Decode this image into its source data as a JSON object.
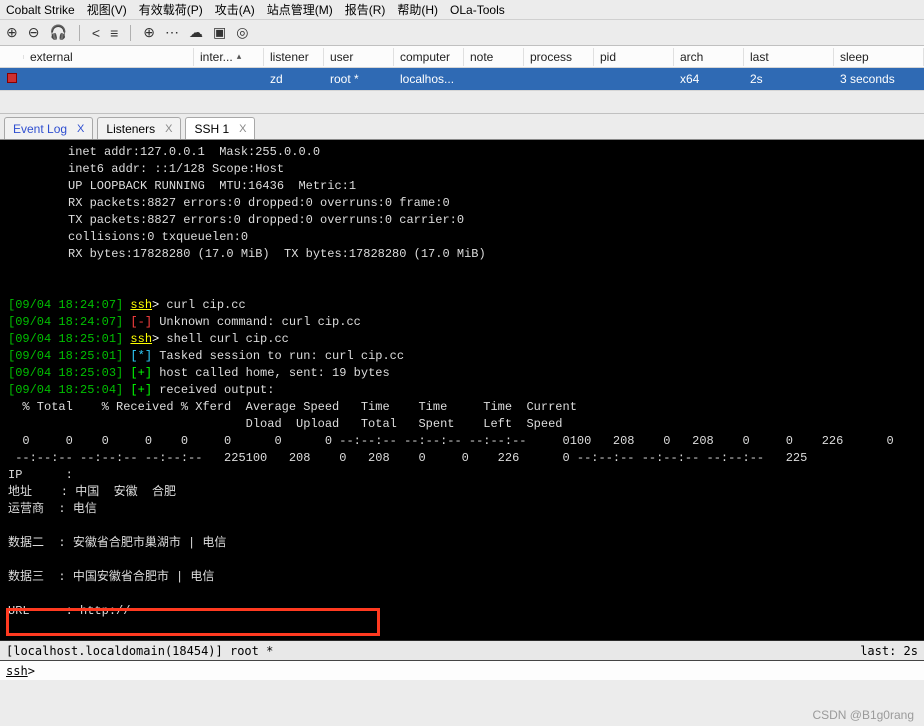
{
  "menubar": {
    "items": [
      "Cobalt Strike",
      "视图(V)",
      "有效载荷(P)",
      "攻击(A)",
      "站点管理(M)",
      "报告(R)",
      "帮助(H)",
      "OLa-Tools"
    ]
  },
  "toolbar": {
    "icons": [
      "plus-icon",
      "minus-circle-icon",
      "headset-icon",
      "share-icon",
      "list-icon",
      "globe-icon",
      "kebab-icon",
      "cloud-icon",
      "target-icon"
    ]
  },
  "targets": {
    "headers": {
      "external": "external",
      "internal": "inter...",
      "listener": "listener",
      "user": "user",
      "computer": "computer",
      "note": "note",
      "process": "process",
      "pid": "pid",
      "arch": "arch",
      "last": "last",
      "sleep": "sleep"
    },
    "row": {
      "external": "",
      "internal": "",
      "listener": "zd       ",
      "user": "root *",
      "computer": "localhos...",
      "note": "",
      "process": "",
      "pid": "",
      "arch": "x64",
      "last": "2s",
      "sleep": "3 seconds"
    }
  },
  "tabs": {
    "items": [
      {
        "label": "Event Log",
        "active": false
      },
      {
        "label": "Listeners",
        "active": false
      },
      {
        "label": "SSH 1",
        "active": true
      }
    ]
  },
  "console": {
    "ifcfg": [
      "inet addr:127.0.0.1  Mask:255.0.0.0",
      "inet6 addr: ::1/128 Scope:Host",
      "UP LOOPBACK RUNNING  MTU:16436  Metric:1",
      "RX packets:8827 errors:0 dropped:0 overruns:0 frame:0",
      "TX packets:8827 errors:0 dropped:0 overruns:0 carrier:0",
      "collisions:0 txqueuelen:0",
      "RX bytes:17828280 (17.0 MiB)  TX bytes:17828280 (17.0 MiB)"
    ],
    "lines": [
      {
        "ts": "[09/04 18:24:07]",
        "tag": "ssh",
        "tagcls": "yellow ul",
        "sym": ">",
        "body": " curl cip.cc"
      },
      {
        "ts": "[09/04 18:24:07]",
        "tag": "[-]",
        "tagcls": "red",
        "sym": "",
        "body": " Unknown command: curl cip.cc"
      },
      {
        "ts": "[09/04 18:25:01]",
        "tag": "ssh",
        "tagcls": "yellow ul",
        "sym": ">",
        "body": " shell curl cip.cc"
      },
      {
        "ts": "[09/04 18:25:01]",
        "tag": "[*]",
        "tagcls": "cyan",
        "sym": "",
        "body": " Tasked session to run: curl cip.cc"
      },
      {
        "ts": "[09/04 18:25:03]",
        "tag": "[+]",
        "tagcls": "lime",
        "sym": "",
        "body": " host called home, sent: 19 bytes"
      },
      {
        "ts": "[09/04 18:25:04]",
        "tag": "[+]",
        "tagcls": "lime",
        "sym": "",
        "body": " received output:"
      }
    ],
    "curl_header": "  % Total    % Received % Xferd  Average Speed   Time    Time     Time  Current",
    "curl_header2": "                                 Dload  Upload   Total   Spent    Left  Speed",
    "curl_row1": "  0     0    0     0    0     0      0      0 --:--:-- --:--:-- --:--:--     0100   208    0   208    0     0    226      0",
    "curl_row2": " --:--:-- --:--:-- --:--:--   225100   208    0   208    0     0    226      0 --:--:-- --:--:-- --:--:--   225",
    "ip_label": "IP      : ",
    "addr_label": "地址    : ",
    "addr_value": "中国  安徽  合肥",
    "isp_label": "运营商  : ",
    "isp_value": "电信",
    "d2_label": "数据二  : ",
    "d2_value": "安徽省合肥市巢湖市 | 电信",
    "d3_label": "数据三  : ",
    "d3_value": "中国安徽省合肥市 | 电信",
    "url_label": "URL     : ",
    "url_value": "http://"
  },
  "status": {
    "left": "[localhost.localdomain(18454)] root *",
    "right": "last: 2s"
  },
  "prompt": {
    "label": "ssh",
    "sep": ">"
  },
  "watermark": "CSDN @B1g0rang"
}
